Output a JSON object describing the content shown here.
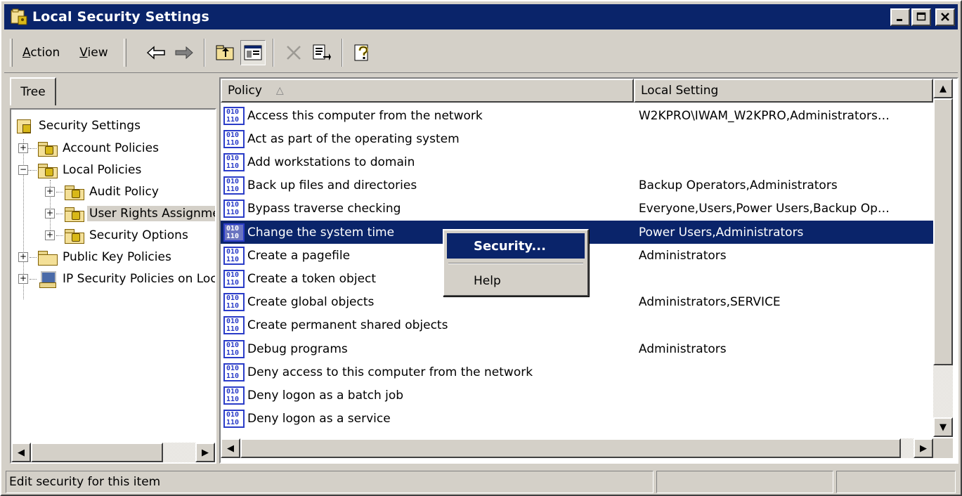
{
  "window": {
    "title": "Local Security Settings",
    "minimize_glyph": "_",
    "maximize_glyph": "□",
    "close_glyph": "✕"
  },
  "menu": {
    "action": {
      "hotkey": "A",
      "rest": "ction"
    },
    "view": {
      "hotkey": "V",
      "rest": "iew"
    }
  },
  "toolbar_icons": [
    "back-arrow-icon",
    "forward-arrow-icon",
    "up-one-level-icon",
    "show-hide-tree-icon",
    "delete-icon",
    "export-list-icon",
    "help-icon"
  ],
  "tree": {
    "tab_label": "Tree",
    "items": [
      {
        "label": "Security Settings"
      },
      {
        "label": "Account Policies",
        "expander": "+"
      },
      {
        "label": "Local Policies",
        "expander": "−"
      },
      {
        "label": "Audit Policy",
        "expander": "+"
      },
      {
        "label": "User Rights Assignment",
        "expander": "+"
      },
      {
        "label": "Security Options",
        "expander": "+"
      },
      {
        "label": "Public Key Policies",
        "expander": "+"
      },
      {
        "label": "IP Security Policies on Local Machine",
        "expander": "+"
      }
    ]
  },
  "list": {
    "columns": {
      "policy": "Policy",
      "sort_indicator": "△",
      "local_setting": "Local Setting"
    },
    "rows": [
      {
        "policy": "Access this computer from the network",
        "setting": "W2KPRO\\IWAM_W2KPRO,Administrators…"
      },
      {
        "policy": "Act as part of the operating system",
        "setting": ""
      },
      {
        "policy": "Add workstations to domain",
        "setting": ""
      },
      {
        "policy": "Back up files and directories",
        "setting": "Backup Operators,Administrators"
      },
      {
        "policy": "Bypass traverse checking",
        "setting": "Everyone,Users,Power Users,Backup Op…"
      },
      {
        "policy": "Change the system time",
        "setting": "Power Users,Administrators"
      },
      {
        "policy": "Create a pagefile",
        "setting": "Administrators"
      },
      {
        "policy": "Create a token object",
        "setting": ""
      },
      {
        "policy": "Create global objects",
        "setting": "Administrators,SERVICE"
      },
      {
        "policy": "Create permanent shared objects",
        "setting": ""
      },
      {
        "policy": "Debug programs",
        "setting": "Administrators"
      },
      {
        "policy": "Deny access to this computer from the network",
        "setting": ""
      },
      {
        "policy": "Deny logon as a batch job",
        "setting": ""
      },
      {
        "policy": "Deny logon as a service",
        "setting": ""
      }
    ]
  },
  "context_menu": {
    "items": [
      "Security...",
      "Help"
    ]
  },
  "statusbar": {
    "text": "Edit security for this item"
  },
  "colors": {
    "titlebar": "#0a246a",
    "selection": "#0a246a",
    "face": "#d4d0c8"
  }
}
